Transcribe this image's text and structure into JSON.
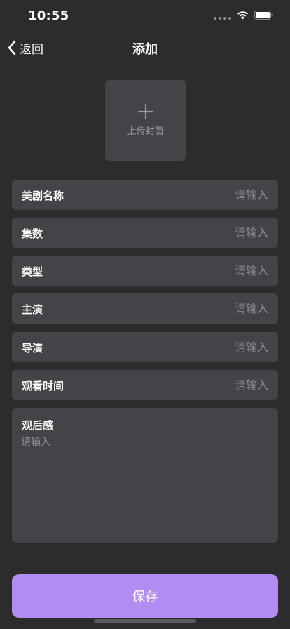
{
  "status_bar": {
    "time": "10:55"
  },
  "nav": {
    "back_label": "返回",
    "title": "添加"
  },
  "cover": {
    "label": "上传封面"
  },
  "fields": [
    {
      "label": "美剧名称",
      "placeholder": "请输入"
    },
    {
      "label": "集数",
      "placeholder": "请输入"
    },
    {
      "label": "类型",
      "placeholder": "请输入"
    },
    {
      "label": "主演",
      "placeholder": "请输入"
    },
    {
      "label": "导演",
      "placeholder": "请输入"
    },
    {
      "label": "观看时间",
      "placeholder": "请输入"
    }
  ],
  "review": {
    "label": "观后感",
    "placeholder": "请输入"
  },
  "save_label": "保存"
}
